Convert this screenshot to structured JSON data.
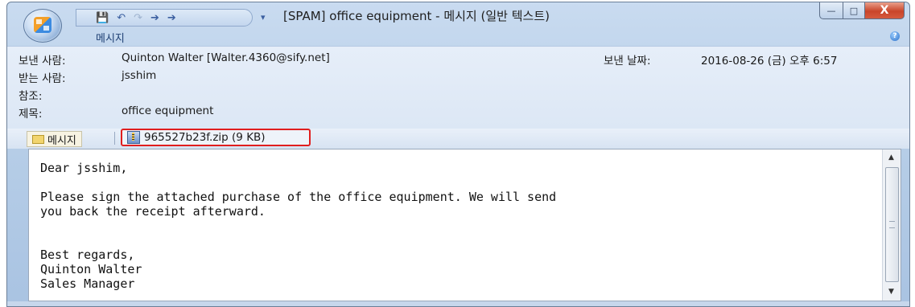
{
  "banner_text": "",
  "window": {
    "title": "[SPAM] office equipment - 메시지 (일반 텍스트)",
    "ribbon_tab": "메시지"
  },
  "quick_access": {
    "icons": [
      "save-icon",
      "undo-icon",
      "redo-icon",
      "up-arrow-icon",
      "down-arrow-icon",
      "customize-icon"
    ]
  },
  "header": {
    "from_label": "보낸 사람:",
    "from_value": "Quinton Walter [Walter.4360@sify.net]",
    "sent_label": "보낸 날짜:",
    "sent_value": "2016-08-26 (금) 오후 6:57",
    "to_label": "받는 사람:",
    "to_value": "jsshim",
    "cc_label": "참조:",
    "cc_value": "",
    "subject_label": "제목:",
    "subject_value": "office equipment"
  },
  "attachments": {
    "message_tab": "메시지",
    "file": "965527b23f.zip (9 KB)"
  },
  "body": {
    "text": "Dear jsshim,\n\nPlease sign the attached purchase of the office equipment. We will send\nyou back the receipt afterward.\n\n\nBest regards,\nQuinton Walter\nSales Manager"
  },
  "colors": {
    "highlight_border": "#e01e1e",
    "close_button": "#c9452a",
    "chrome_blue": "#b8cfe8"
  }
}
